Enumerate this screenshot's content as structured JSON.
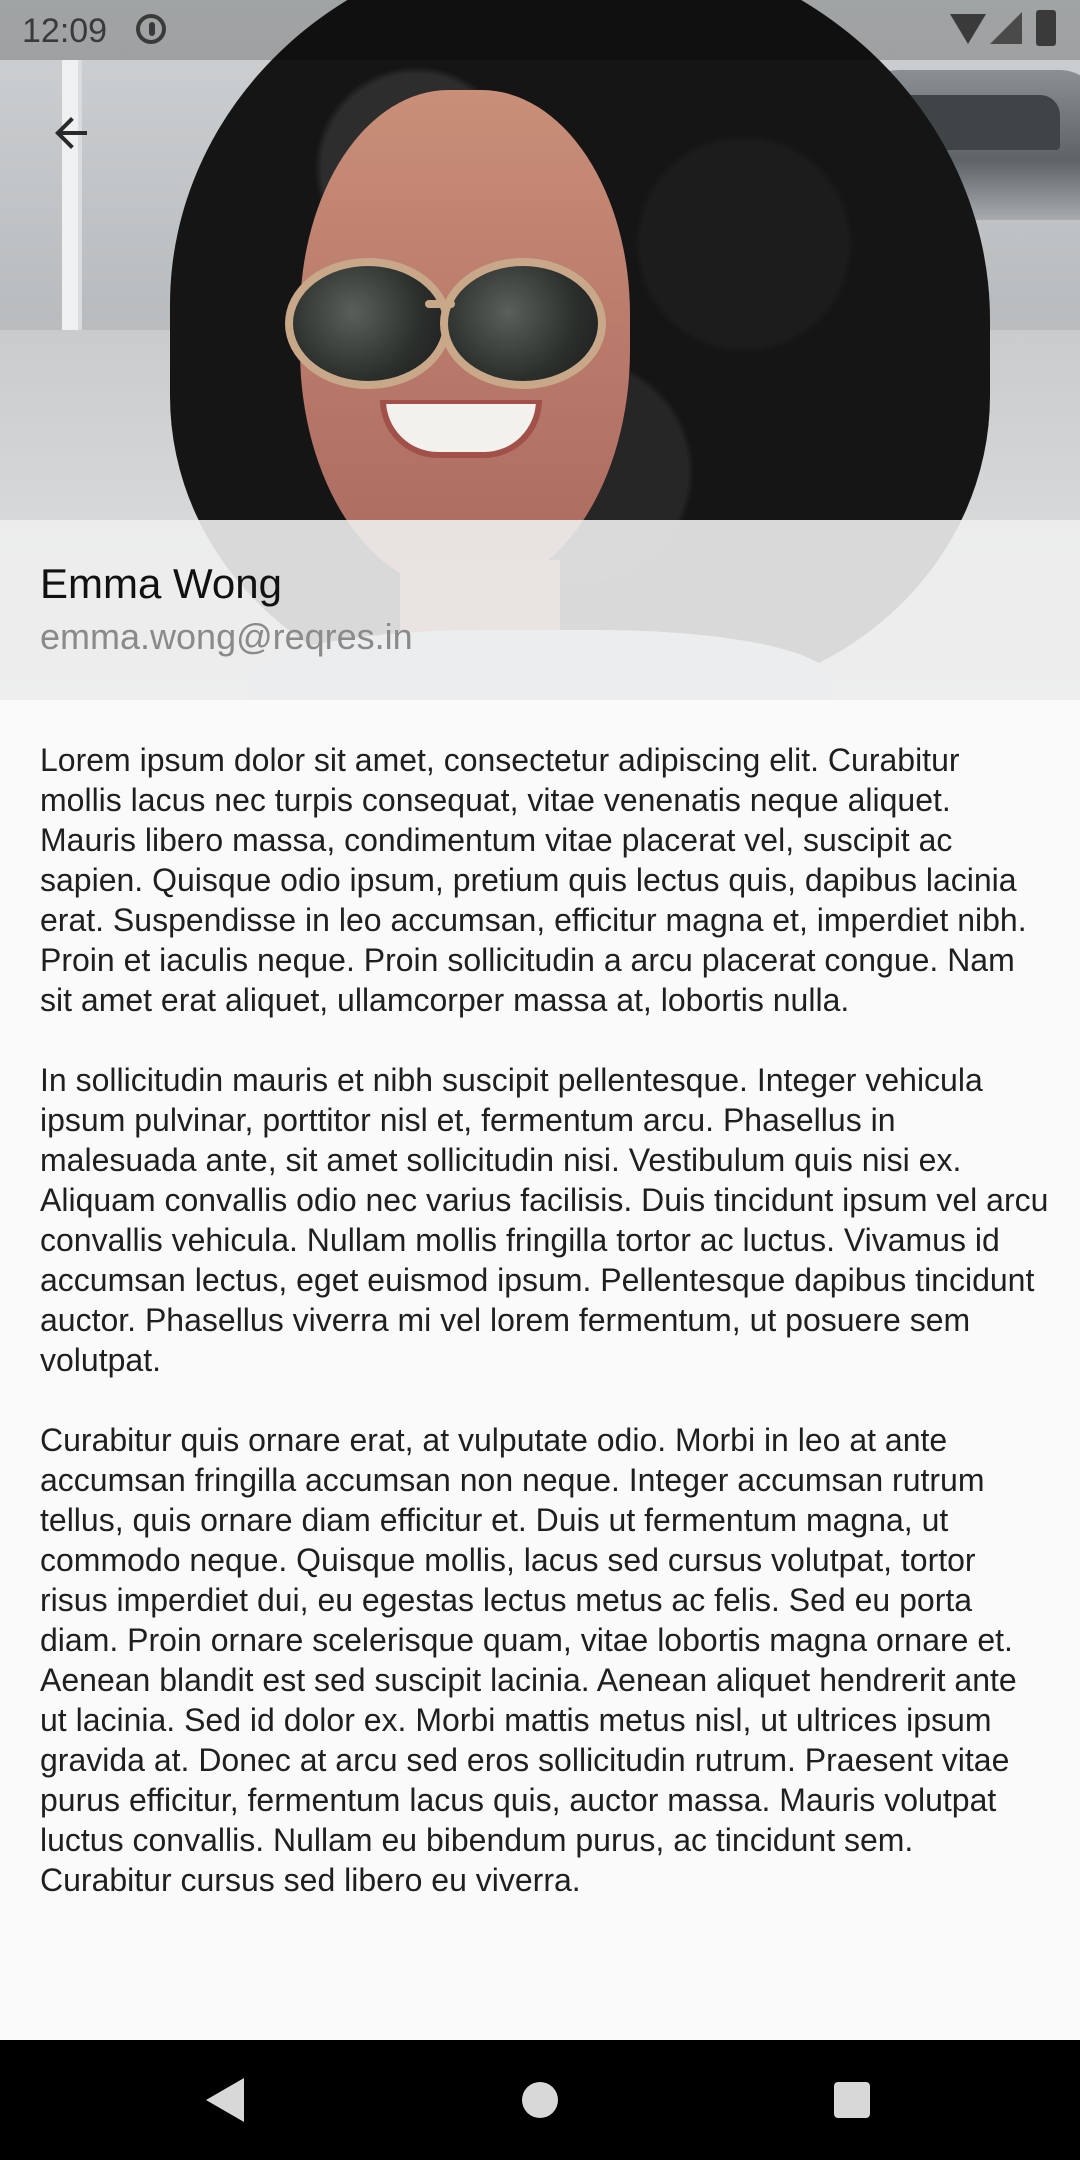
{
  "status_bar": {
    "time": "12:09",
    "icons": [
      "do-not-disturb-icon",
      "wifi-icon",
      "cell-signal-icon",
      "battery-icon"
    ]
  },
  "header": {
    "back_icon": "arrow-back-icon"
  },
  "profile": {
    "name": "Emma Wong",
    "email": "emma.wong@reqres.in"
  },
  "content": {
    "paragraphs": [
      "Lorem ipsum dolor sit amet, consectetur adipiscing elit. Curabitur mollis lacus nec turpis consequat, vitae venenatis neque aliquet. Mauris libero massa, condimentum vitae placerat vel, suscipit ac sapien. Quisque odio ipsum, pretium quis lectus quis, dapibus lacinia erat. Suspendisse in leo accumsan, efficitur magna et, imperdiet nibh. Proin et iaculis neque. Proin sollicitudin a arcu placerat congue. Nam sit amet erat aliquet, ullamcorper massa at, lobortis nulla.",
      "In sollicitudin mauris et nibh suscipit pellentesque. Integer vehicula ipsum pulvinar, porttitor nisl et, fermentum arcu. Phasellus in malesuada ante, sit amet sollicitudin nisi. Vestibulum quis nisi ex. Aliquam convallis odio nec varius facilisis. Duis tincidunt ipsum vel arcu convallis vehicula. Nullam mollis fringilla tortor ac luctus. Vivamus id accumsan lectus, eget euismod ipsum. Pellentesque dapibus tincidunt auctor. Phasellus viverra mi vel lorem fermentum, ut posuere sem volutpat.",
      "Curabitur quis ornare erat, at vulputate odio. Morbi in leo at ante accumsan fringilla accumsan non neque. Integer accumsan rutrum tellus, quis ornare diam efficitur et. Duis ut fermentum magna, ut commodo neque. Quisque mollis, lacus sed cursus volutpat, tortor risus imperdiet dui, eu egestas lectus metus ac felis. Sed eu porta diam. Proin ornare scelerisque quam, vitae lobortis magna ornare et. Aenean blandit est sed suscipit lacinia. Aenean aliquet hendrerit ante ut lacinia. Sed id dolor ex. Morbi mattis metus nisl, ut ultrices ipsum gravida at. Donec at arcu sed eros sollicitudin rutrum. Praesent vitae purus efficitur, fermentum lacus quis, auctor massa. Mauris volutpat luctus convallis. Nullam eu bibendum purus, ac tincidunt sem. Curabitur cursus sed libero eu viverra."
    ]
  },
  "nav_bar": {
    "icons": [
      "nav-back-icon",
      "nav-home-icon",
      "nav-recents-icon"
    ]
  }
}
